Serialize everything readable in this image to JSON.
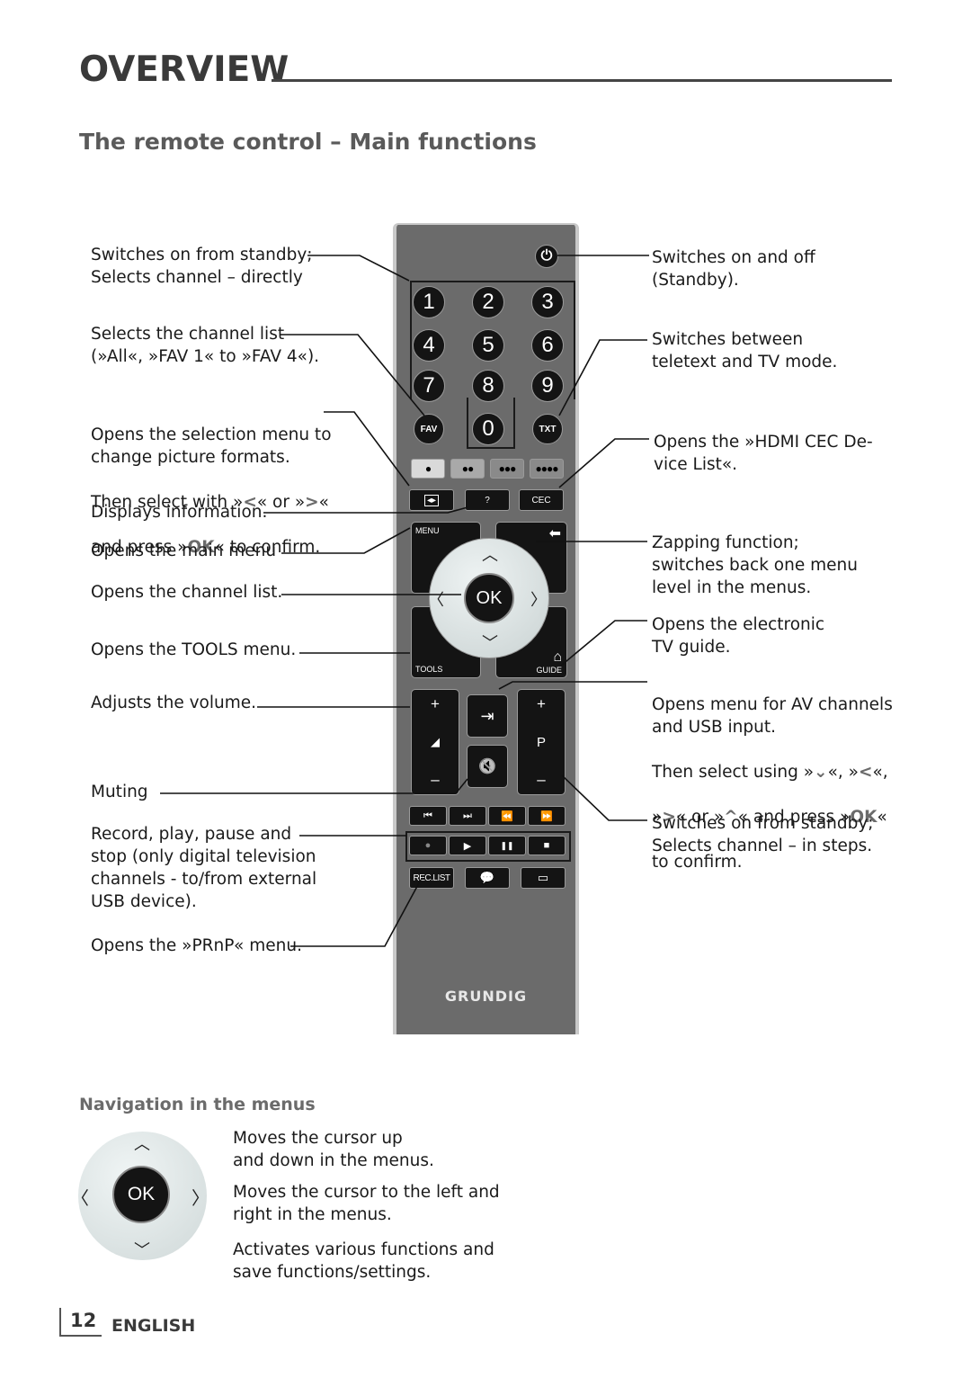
{
  "header": {
    "section_title": "OVERVIEW",
    "subtitle": "The remote control – Main functions"
  },
  "left_labels": [
    {
      "id": "standby-direct",
      "text": "Switches on from standby;\nSelects channel – directly"
    },
    {
      "id": "channel-list-select",
      "text": "Selects the channel list\n(»All«, »FAV 1« to »FAV 4«)."
    },
    {
      "id": "picture-format",
      "line1": "Opens the selection menu to\nchange picture formats.",
      "line2a": "Then select with »",
      "glyph_left": "<",
      "line2b": "« or »",
      "glyph_right": ">",
      "line2c": "«",
      "line3a": "and press »",
      "glyph_ok": "OK",
      "line3b": "« to confirm."
    },
    {
      "id": "info",
      "text": "Displays information."
    },
    {
      "id": "main-menu",
      "text": "Opens the main menu"
    },
    {
      "id": "channel-list",
      "text": "Opens the channel list."
    },
    {
      "id": "tools-menu",
      "text": "Opens the TOOLS menu."
    },
    {
      "id": "volume",
      "text": "Adjusts the volume."
    },
    {
      "id": "muting",
      "text": "Muting"
    },
    {
      "id": "media",
      "text": "Record, play, pause and\nstop (only digital television\nchannels - to/from external\nUSB device)."
    },
    {
      "id": "prnp",
      "text": "Opens the »PRnP« menu."
    }
  ],
  "right_labels": [
    {
      "id": "power",
      "text": "Switches on and off\n(Standby)."
    },
    {
      "id": "teletext",
      "text": "Switches between\nteletext and TV mode."
    },
    {
      "id": "hdmi-cec",
      "text": "Opens the »HDMI CEC De-\nvice List«."
    },
    {
      "id": "zapping",
      "text": "Zapping function;\nswitches back one menu\nlevel in the menus."
    },
    {
      "id": "epg",
      "text": "Opens the electronic\nTV guide."
    },
    {
      "id": "av-usb",
      "line1": "Opens menu for AV channels\nand USB input.",
      "l2a": "Then select using »",
      "g_down": "⌄",
      "l2b": "«, »",
      "g_left": "<",
      "l2c": "«,",
      "l3a": "»",
      "g_right": ">",
      "l3b": "« or »",
      "g_up": "^",
      "l3c": "« and press »",
      "g_ok": "OK",
      "l3d": "«",
      "line4": "to confirm."
    },
    {
      "id": "channel-steps",
      "text": "Switches on from standby;\nSelects channel – in steps."
    }
  ],
  "remote": {
    "brand": "GRUNDIG",
    "power_icon": "⏻",
    "digits": [
      "1",
      "2",
      "3",
      "4",
      "5",
      "6",
      "7",
      "8",
      "9"
    ],
    "zero": "0",
    "fav": "FAV",
    "txt": "TXT",
    "color_buttons": [
      "●",
      "●●",
      "●●●",
      "●●●●"
    ],
    "color_button_fills": [
      "#d9d9d9",
      "#a9a9a9",
      "#8a8a8a",
      "#8a8a8a"
    ],
    "format_icon": "◂▸",
    "info": "?",
    "cec": "CEC",
    "menu": "MENU",
    "back_icon": "⬅",
    "ok": "OK",
    "up": "︿",
    "down": "﹀",
    "left": "〈",
    "right": "〉",
    "tools": "TOOLS",
    "guide": "GUIDE",
    "home_icon": "⌂",
    "vol_plus": "+",
    "vol_minus": "–",
    "vol_icon": "◢",
    "source_icon": "⇥",
    "mute_icon": "🔇",
    "prog_plus": "+",
    "prog_label": "P",
    "prog_minus": "–",
    "media_row1": [
      "⏮",
      "⏭",
      "⏪",
      "⏩"
    ],
    "media_row2": [
      "●",
      "▶",
      "❚❚",
      "■"
    ],
    "rec_list": "REC.LIST",
    "chat_icon": "💬",
    "subtitle_icon": "▭"
  },
  "navigation": {
    "title": "Navigation in the menus",
    "ok": "OK",
    "up": "︿",
    "down": "﹀",
    "left": "〈",
    "right": "〉",
    "items": [
      "Moves the cursor up\nand down in the menus.",
      "Moves the cursor to the left and\nright in the menus.",
      "Activates various functions and\nsave functions/settings."
    ]
  },
  "footer": {
    "page_number": "12",
    "language": "ENGLISH"
  }
}
